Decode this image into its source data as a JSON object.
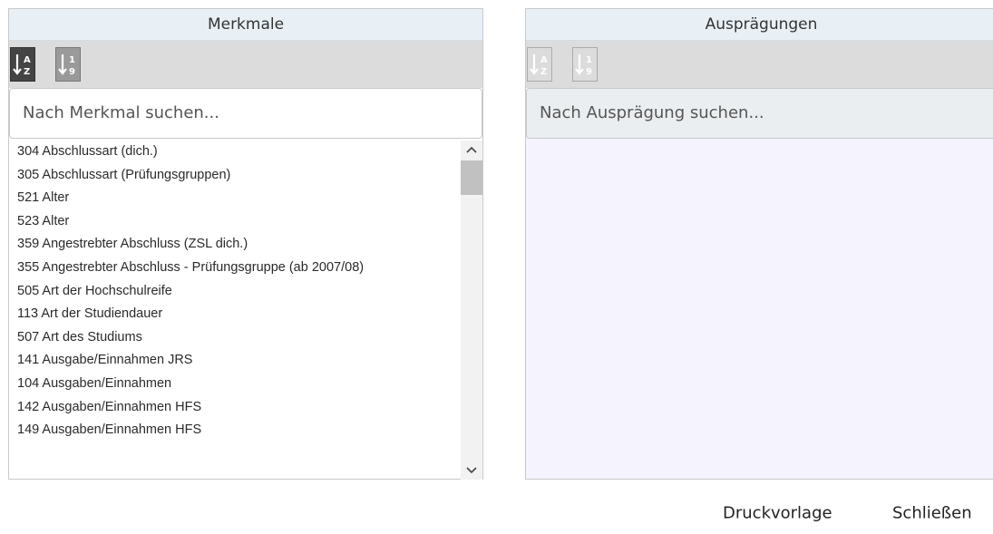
{
  "left_panel": {
    "title": "Merkmale",
    "sort_alpha_icon": "sort-alpha-icon",
    "sort_numeric_icon": "sort-numeric-icon",
    "search_placeholder": "Nach Merkmal suchen...",
    "items": [
      "304 Abschlussart (dich.)",
      "305 Abschlussart (Prüfungsgruppen)",
      "521 Alter",
      "523 Alter",
      "359 Angestrebter Abschluss (ZSL dich.)",
      "355 Angestrebter Abschluss - Prüfungsgruppe (ab 2007/08)",
      "505 Art der Hochschulreife",
      "113 Art der Studiendauer",
      "507 Art des Studiums",
      "141 Ausgabe/Einnahmen JRS",
      "104 Ausgaben/Einnahmen",
      "142 Ausgaben/Einnahmen HFS",
      "149 Ausgaben/Einnahmen HFS"
    ]
  },
  "right_panel": {
    "title": "Ausprägungen",
    "search_placeholder": "Nach Ausprägung suchen..."
  },
  "footer": {
    "print_label": "Druckvorlage",
    "close_label": "Schließen"
  }
}
